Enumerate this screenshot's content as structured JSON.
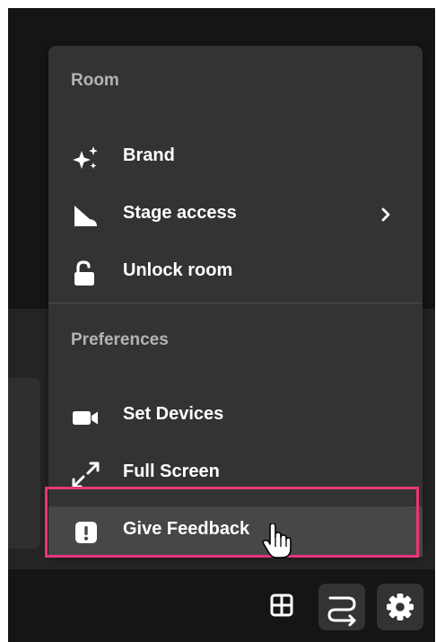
{
  "menu": {
    "room_section": {
      "label": "Room",
      "items": [
        {
          "label": "Brand",
          "icon": "sparkles-icon"
        },
        {
          "label": "Stage access",
          "icon": "stage-icon",
          "has_submenu": true
        },
        {
          "label": "Unlock room",
          "icon": "unlock-icon"
        }
      ]
    },
    "preferences_section": {
      "label": "Preferences",
      "items": [
        {
          "label": "Set Devices",
          "icon": "camera-icon"
        },
        {
          "label": "Full Screen",
          "icon": "fullscreen-icon"
        },
        {
          "label": "Give Feedback",
          "icon": "feedback-icon",
          "hovered": true
        }
      ]
    }
  },
  "bottom_bar": {
    "buttons": [
      {
        "icon": "grid-icon"
      },
      {
        "icon": "swap-layout-icon"
      },
      {
        "icon": "gear-icon"
      }
    ]
  },
  "colors": {
    "background": "#151515",
    "menu_background": "#333333",
    "hover_background": "#474747",
    "section_label": "#b4b4b4",
    "text": "#ffffff",
    "highlight_border": "#e8357a"
  }
}
